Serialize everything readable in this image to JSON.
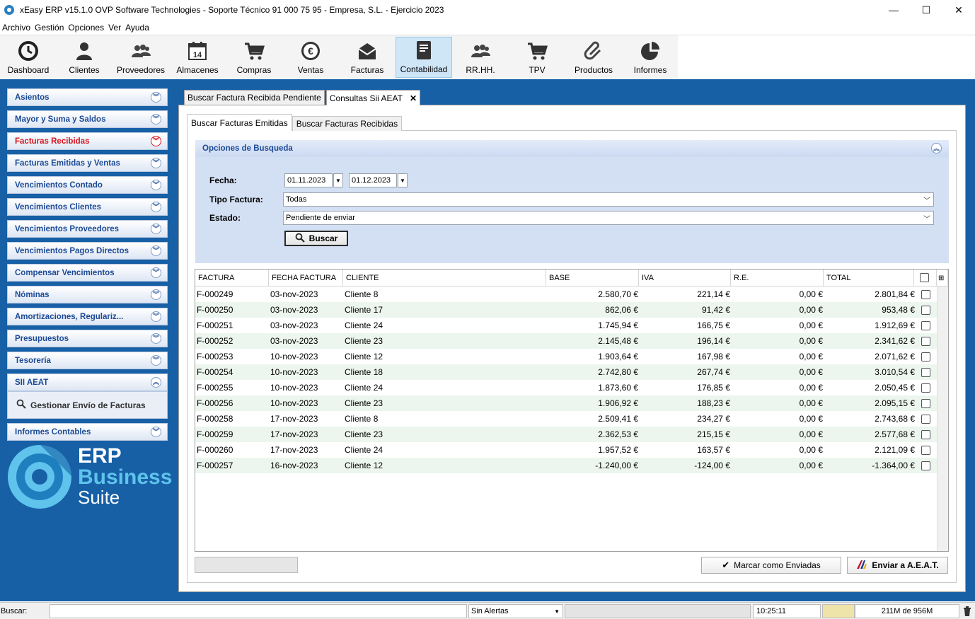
{
  "window": {
    "title": "xEasy ERP v15.1.0 OVP Software Technologies - Soporte Técnico 91 000 75 95 - Empresa, S.L. - Ejercicio 2023",
    "minimize": "—",
    "maximize": "☐",
    "close": "✕"
  },
  "menu": [
    "Archivo",
    "Gestión",
    "Opciones",
    "Ver",
    "Ayuda"
  ],
  "toolbar": [
    {
      "label": "Dashboard",
      "icon": "clock-icon"
    },
    {
      "label": "Clientes",
      "icon": "person-icon"
    },
    {
      "label": "Proveedores",
      "icon": "people-icon"
    },
    {
      "label": "Almacenes",
      "icon": "calendar-icon",
      "badge": "14"
    },
    {
      "label": "Compras",
      "icon": "cart-icon"
    },
    {
      "label": "Ventas",
      "icon": "euro-icon"
    },
    {
      "label": "Facturas",
      "icon": "envelope-icon"
    },
    {
      "label": "Contabilidad",
      "icon": "book-icon",
      "active": true
    },
    {
      "label": "RR.HH.",
      "icon": "team-icon"
    },
    {
      "label": "TPV",
      "icon": "pos-cart-icon"
    },
    {
      "label": "Productos",
      "icon": "paperclip-icon"
    },
    {
      "label": "Informes",
      "icon": "pie-chart-icon"
    }
  ],
  "sidebar": {
    "items": [
      {
        "label": "Asientos"
      },
      {
        "label": "Mayor y Suma y Saldos"
      },
      {
        "label": "Facturas Recibidas",
        "highlight": true
      },
      {
        "label": "Facturas Emitidas y Ventas"
      },
      {
        "label": "Vencimientos Contado"
      },
      {
        "label": "Vencimientos Clientes"
      },
      {
        "label": "Vencimientos Proveedores"
      },
      {
        "label": "Vencimientos Pagos Directos"
      },
      {
        "label": "Compensar Vencimientos"
      },
      {
        "label": "Nóminas"
      },
      {
        "label": "Amortizaciones, Regulariz..."
      },
      {
        "label": "Presupuestos"
      },
      {
        "label": "Tesorería"
      },
      {
        "label": "SII AEAT",
        "expanded": true
      }
    ],
    "sii_action": "Gestionar Envío de Facturas",
    "last_item": "Informes Contables",
    "logo": {
      "line1": "ERP",
      "line2": "Business",
      "line3": "Suite"
    }
  },
  "doc_tabs": {
    "tab1": "Buscar Factura Recibida Pendiente",
    "tab2": "Consultas Sii AEAT",
    "close": "✕"
  },
  "sub_tabs": {
    "emitidas": "Buscar Facturas Emitidas",
    "recibidas": "Buscar Facturas Recibidas"
  },
  "search": {
    "header": "Opciones de Busqueda",
    "fecha_label": "Fecha:",
    "fecha_desde": "01.11.2023",
    "fecha_hasta": "01.12.2023",
    "tipo_label": "Tipo Factura:",
    "tipo_value": "Todas",
    "estado_label": "Estado:",
    "estado_value": "Pendiente de enviar",
    "buscar": "Buscar"
  },
  "grid": {
    "columns": [
      "FACTURA",
      "FECHA FACTURA",
      "CLIENTE",
      "BASE",
      "IVA",
      "R.E.",
      "TOTAL"
    ],
    "rows": [
      [
        "F-000249",
        "03-nov-2023",
        "Cliente 8",
        "2.580,70 €",
        "221,14 €",
        "0,00 €",
        "2.801,84 €"
      ],
      [
        "F-000250",
        "03-nov-2023",
        "Cliente 17",
        "862,06 €",
        "91,42 €",
        "0,00 €",
        "953,48 €"
      ],
      [
        "F-000251",
        "03-nov-2023",
        "Cliente 24",
        "1.745,94 €",
        "166,75 €",
        "0,00 €",
        "1.912,69 €"
      ],
      [
        "F-000252",
        "03-nov-2023",
        "Cliente 23",
        "2.145,48 €",
        "196,14 €",
        "0,00 €",
        "2.341,62 €"
      ],
      [
        "F-000253",
        "10-nov-2023",
        "Cliente 12",
        "1.903,64 €",
        "167,98 €",
        "0,00 €",
        "2.071,62 €"
      ],
      [
        "F-000254",
        "10-nov-2023",
        "Cliente 18",
        "2.742,80 €",
        "267,74 €",
        "0,00 €",
        "3.010,54 €"
      ],
      [
        "F-000255",
        "10-nov-2023",
        "Cliente 24",
        "1.873,60 €",
        "176,85 €",
        "0,00 €",
        "2.050,45 €"
      ],
      [
        "F-000256",
        "10-nov-2023",
        "Cliente 23",
        "1.906,92 €",
        "188,23 €",
        "0,00 €",
        "2.095,15 €"
      ],
      [
        "F-000258",
        "17-nov-2023",
        "Cliente 8",
        "2.509,41 €",
        "234,27 €",
        "0,00 €",
        "2.743,68 €"
      ],
      [
        "F-000259",
        "17-nov-2023",
        "Cliente 23",
        "2.362,53 €",
        "215,15 €",
        "0,00 €",
        "2.577,68 €"
      ],
      [
        "F-000260",
        "17-nov-2023",
        "Cliente 24",
        "1.957,52 €",
        "163,57 €",
        "0,00 €",
        "2.121,09 €"
      ],
      [
        "F-000257",
        "16-nov-2023",
        "Cliente 12",
        "-1.240,00 €",
        "-124,00 €",
        "0,00 €",
        "-1.364,00 €"
      ]
    ]
  },
  "footer": {
    "marcar": "Marcar como Enviadas",
    "enviar": "Enviar a A.E.A.T."
  },
  "statusbar": {
    "buscar_label": "Buscar:",
    "alertas": "Sin Alertas",
    "time": "10:25:11",
    "memory": "211M de 956M"
  },
  "colors": {
    "accent": "#1760a6",
    "sidebar_text": "#1c4a96",
    "highlight_text": "#d8141e",
    "row_alt": "#ecf6ee"
  }
}
